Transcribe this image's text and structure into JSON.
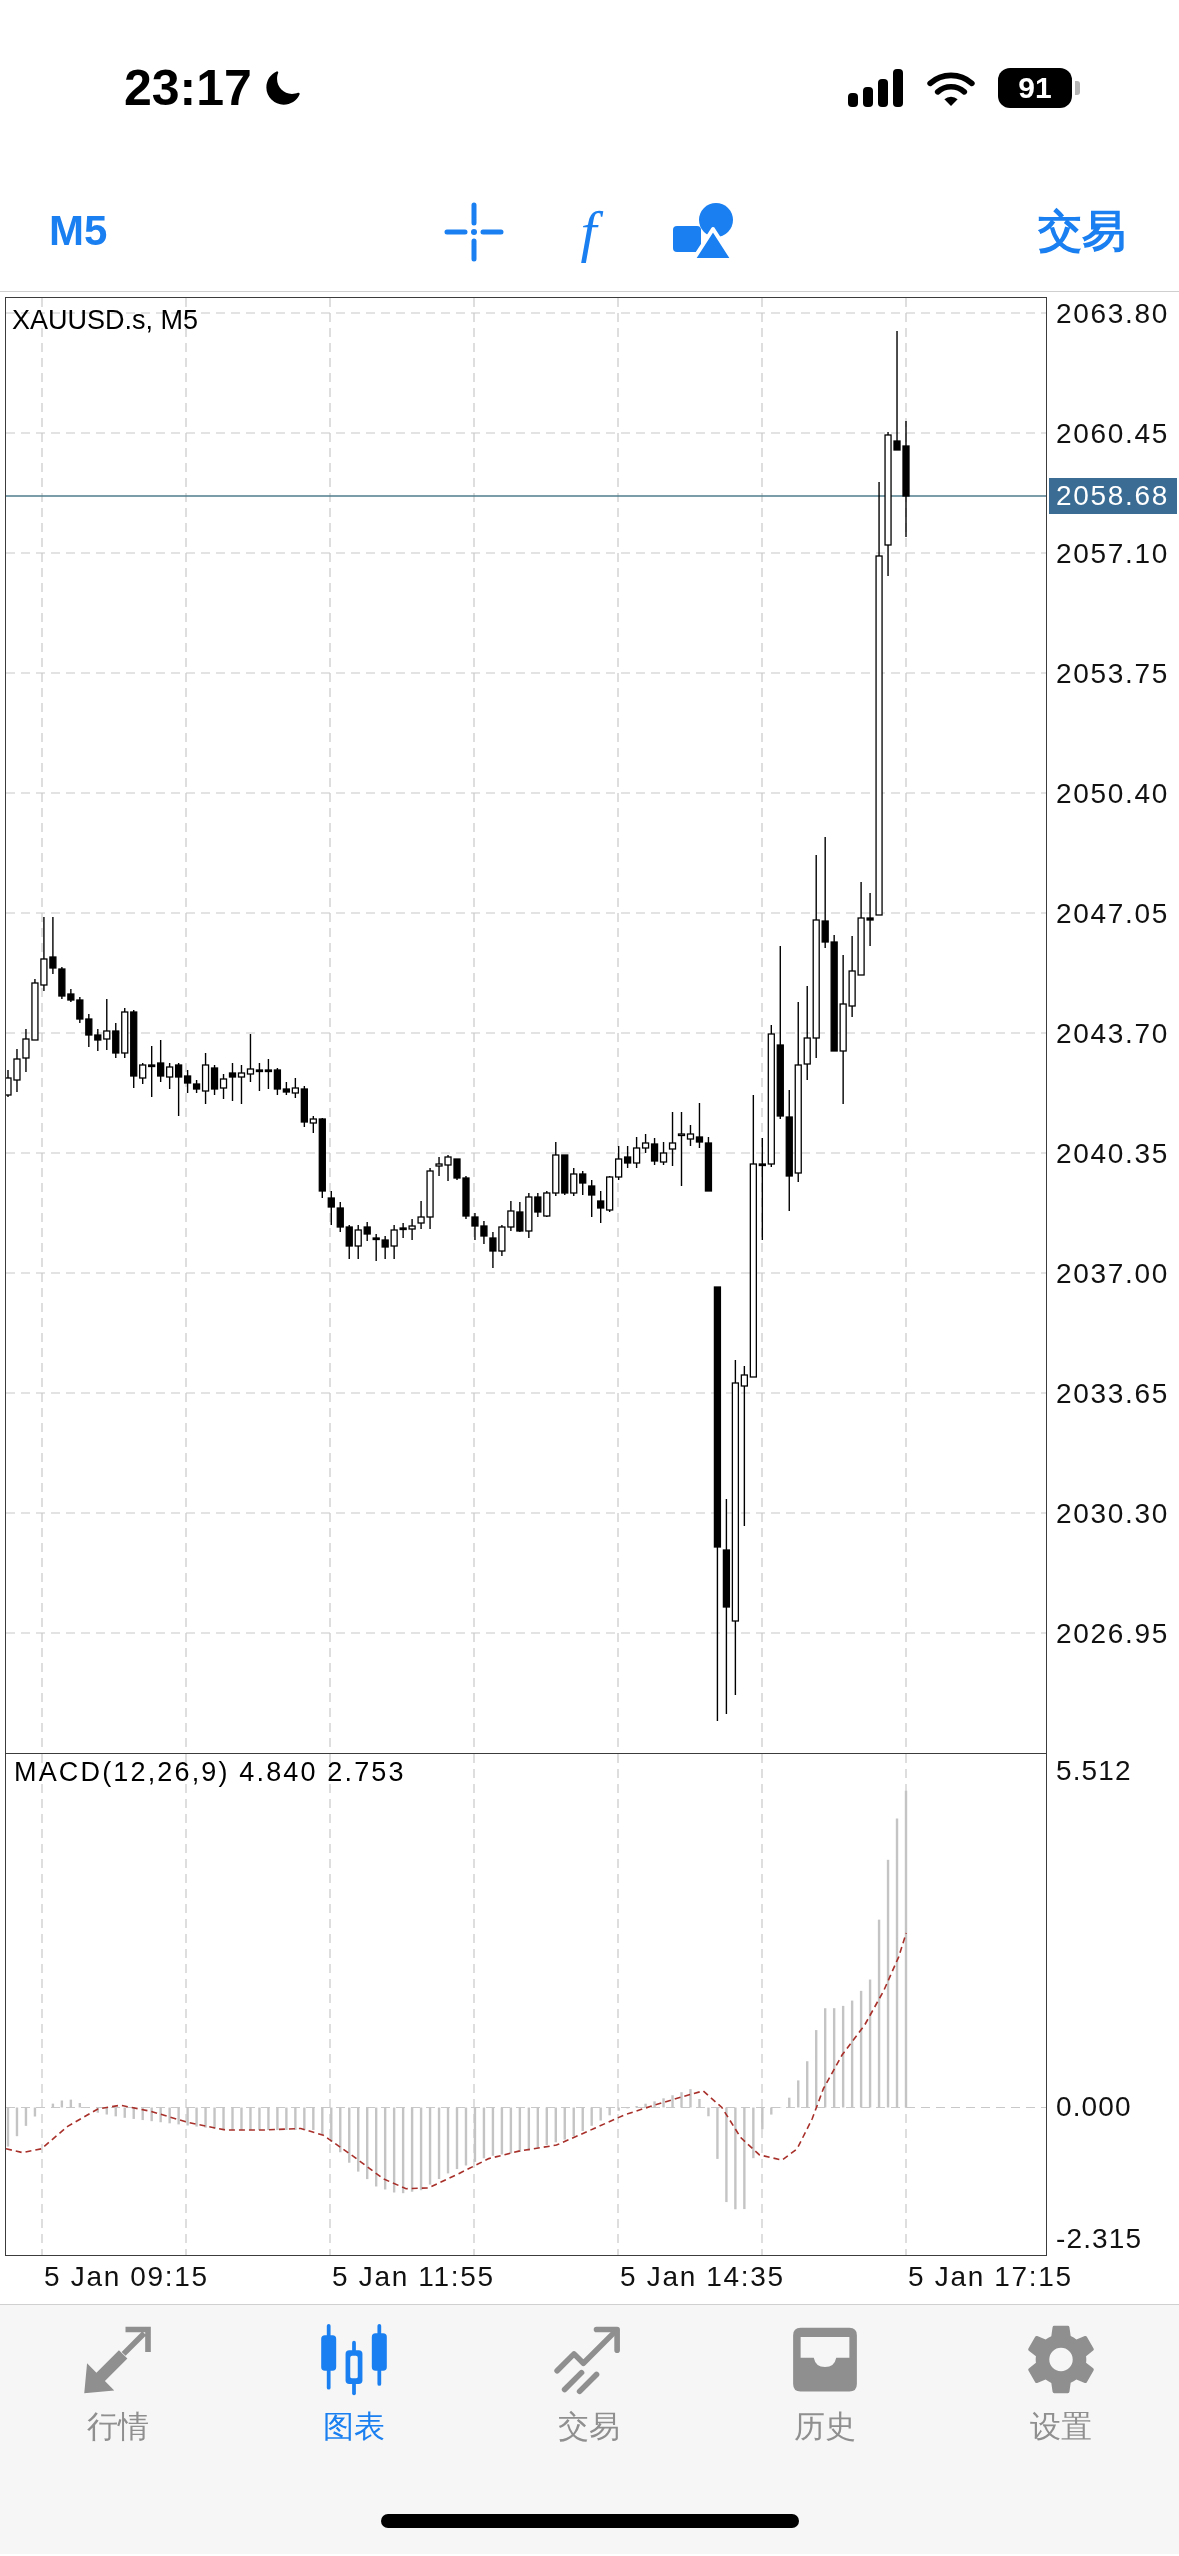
{
  "status_bar": {
    "time": "23:17",
    "battery": "91"
  },
  "toolbar": {
    "timeframe": "M5",
    "indicators": "f",
    "trade": "交易"
  },
  "chart": {
    "symbol": "XAUUSD.s, M5",
    "price_axis": [
      "2063.80",
      "2060.45",
      "2057.10",
      "2053.75",
      "2050.40",
      "2047.05",
      "2043.70",
      "2040.35",
      "2037.00",
      "2033.65",
      "2030.30",
      "2026.95"
    ],
    "current_price": "2058.68",
    "time_axis": [
      "5 Jan 09:15",
      "5 Jan 11:55",
      "5 Jan 14:35",
      "5 Jan 17:15"
    ]
  },
  "macd": {
    "label": "MACD(12,26,9) 4.840 2.753",
    "axis": [
      "5.512",
      "0.000",
      "-2.315"
    ]
  },
  "tabs": [
    {
      "label": "行情",
      "selected": false
    },
    {
      "label": "图表",
      "selected": true
    },
    {
      "label": "交易",
      "selected": false
    },
    {
      "label": "历史",
      "selected": false
    },
    {
      "label": "设置",
      "selected": false
    }
  ]
}
